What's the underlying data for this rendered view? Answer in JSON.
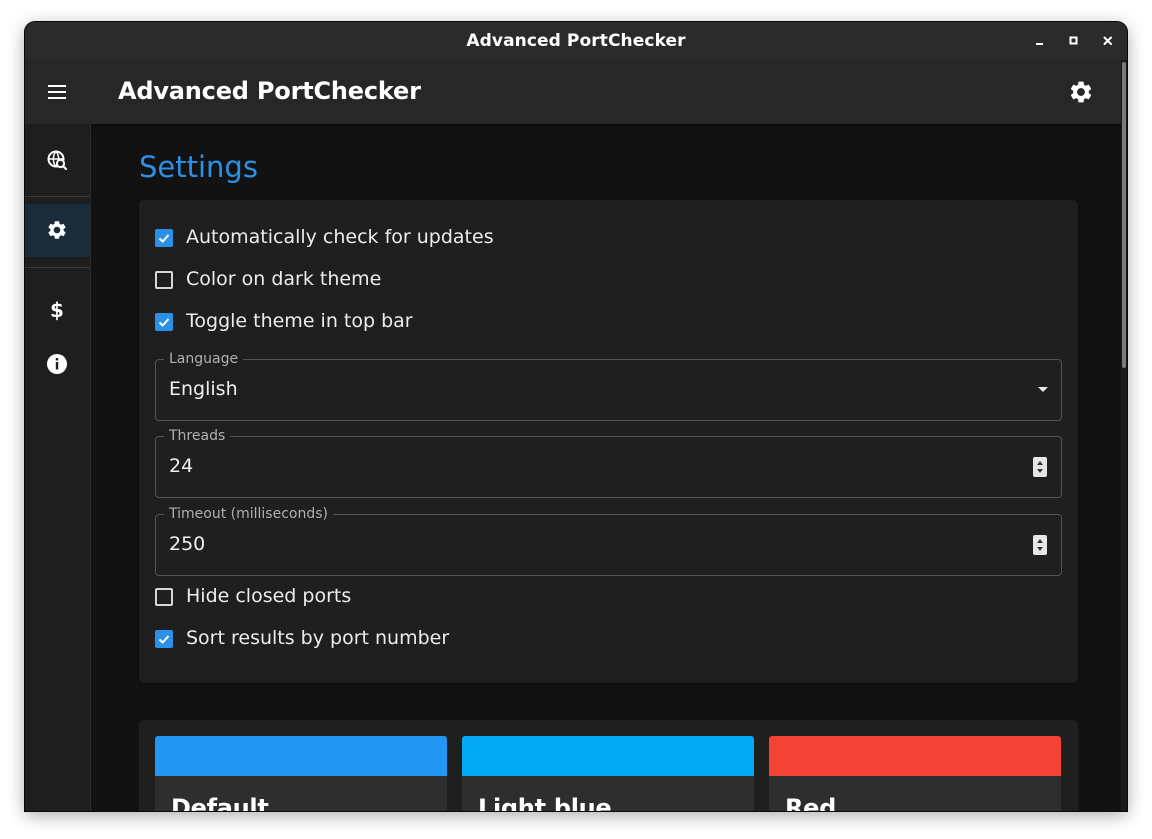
{
  "window": {
    "title": "Advanced PortChecker"
  },
  "appbar": {
    "title": "Advanced PortChecker",
    "settings_icon": "gear-icon",
    "menu_icon": "hamburger-icon"
  },
  "drawer": {
    "items": [
      {
        "name": "scan",
        "icon": "globe-search-icon",
        "active": false
      },
      {
        "name": "settings",
        "icon": "gear-icon",
        "active": true
      },
      {
        "name": "donate",
        "icon": "dollar-icon",
        "active": false
      },
      {
        "name": "about",
        "icon": "info-icon",
        "active": false
      }
    ]
  },
  "settings": {
    "title": "Settings",
    "auto_update": {
      "label": "Automatically check for updates",
      "checked": true
    },
    "color_dark": {
      "label": "Color on dark theme",
      "checked": false
    },
    "toggle_theme": {
      "label": "Toggle theme in top bar",
      "checked": true
    },
    "language": {
      "label": "Language",
      "value": "English"
    },
    "threads": {
      "label": "Threads",
      "value": "24"
    },
    "timeout": {
      "label": "Timeout (milliseconds)",
      "value": "250"
    },
    "hide_closed": {
      "label": "Hide closed ports",
      "checked": false
    },
    "sort_results": {
      "label": "Sort results by port number",
      "checked": true
    }
  },
  "themes": [
    {
      "name": "Default",
      "color": "#2196f3"
    },
    {
      "name": "Light blue",
      "color": "#03a9f4"
    },
    {
      "name": "Red",
      "color": "#f44336"
    }
  ],
  "colors": {
    "accent": "#2b90e6",
    "background": "#121212",
    "card": "#1f1f1f",
    "appbar": "#272727"
  }
}
